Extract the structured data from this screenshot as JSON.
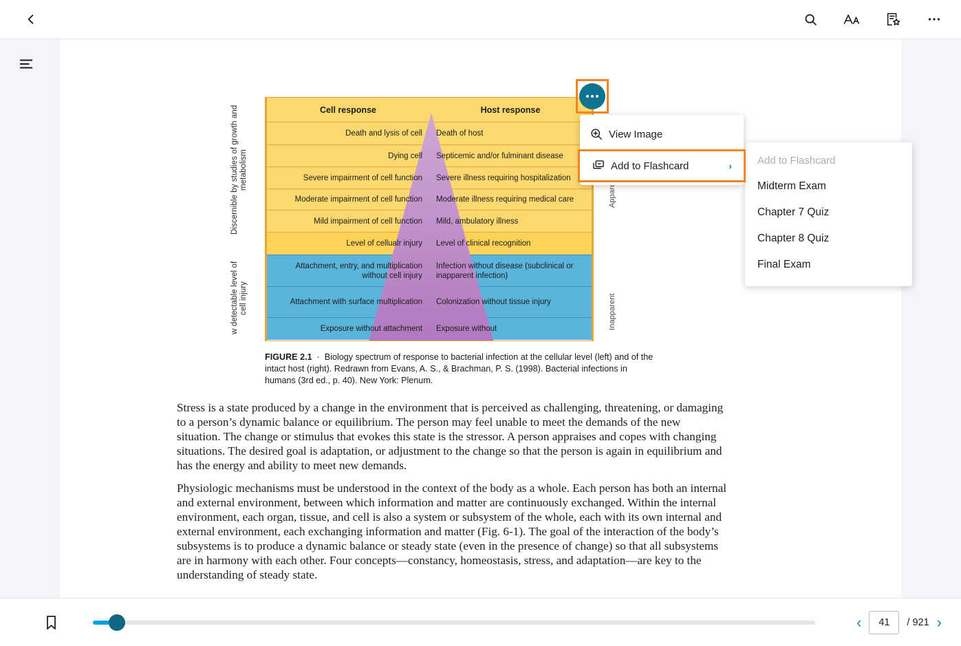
{
  "topbar": {
    "back_label": "Back",
    "icons": [
      {
        "name": "search-icon",
        "label": "Search"
      },
      {
        "name": "text-size-icon",
        "label": "Text Size"
      },
      {
        "name": "notes-star-icon",
        "label": "Notes and Highlights"
      },
      {
        "name": "more-options-icon",
        "label": "More"
      }
    ]
  },
  "rail": {
    "menu_label": "Contents"
  },
  "figure": {
    "left_axis_top": "Discernible by studies of growth and metabolism",
    "left_axis_bottom": "w detectable level of cell injury",
    "right_axis_top": "Appare",
    "right_axis_bottom": "Inapparent",
    "header": {
      "left": "Cell response",
      "right": "Host response"
    },
    "rows": [
      {
        "left": "Death and lysis of cell",
        "right": "Death of host",
        "band": "yellow"
      },
      {
        "left": "Dying cell",
        "right": "Septicemic and/or fulminant disease",
        "band": "yellow"
      },
      {
        "left": "Severe impairment of cell function",
        "right": "Severe illness requiring hospitalization",
        "band": "yellow"
      },
      {
        "left": "Moderate impairment of cell function",
        "right": "Moderate illness requiring medical care",
        "band": "yellow"
      },
      {
        "left": "Mild impairment of cell function",
        "right": "Mild, ambulatory illness",
        "band": "yellow"
      },
      {
        "left": "Level of cellualr injury",
        "right": "Level of clinical recognition",
        "band": "yellow2"
      },
      {
        "left": "Attachment, entry, and multiplication without cell injury",
        "right": "Infection without disease (subclinical or inapparent infection)",
        "band": "blue"
      },
      {
        "left": "Attachment with surface multiplication",
        "right": "Colonization without tissue injury",
        "band": "blue"
      },
      {
        "left": "Exposure without attachment",
        "right": "Exposure without",
        "band": "blue"
      }
    ],
    "caption_label": "FIGURE 2.1",
    "caption_sep": "·",
    "caption_text": "Biology spectrum of response to bacterial infection at the cellular level (left) and of the intact host (right). Redrawn from Evans, A. S., & Brachman, P. S. (1998). Bacterial infections in humans (3rd ed., p. 40). New York: Plenum."
  },
  "body": {
    "paragraph_1": "Stress is a state produced by a change in the environment that is perceived as challenging, threatening, or damaging to a person’s dynamic balance or equilibrium. The person may feel unable to meet the demands of the new situation. The change or stimulus that evokes this state is the stressor. A person appraises and copes with changing situations. The desired goal is adaptation, or adjustment to the change so that the person is again in equilibrium and has the energy and ability to meet new demands.",
    "paragraph_2": "Physiologic mechanisms must be understood in the context of the body as a whole. Each person has both an internal and external environment, between which information and matter are continuously exchanged. Within the internal environment, each organ, tissue, and cell is also a system or subsystem of the whole, each with its own internal and external environment, each exchanging information and matter (Fig. 6-1). The goal of the interaction of the body’s subsystems is to produce a dynamic balance or steady state (even in the presence of change) so that all subsystems are in harmony with each other. Four concepts—constancy, homeostasis, stress, and adaptation—are key to the understanding of steady state."
  },
  "context_menu": {
    "trigger_label": "More image options",
    "items": [
      {
        "label": "View Image",
        "icon": "zoom-in-icon",
        "has_arrow": false,
        "highlighted": false
      },
      {
        "label": "Add to Flashcard",
        "icon": "flashcard-icon",
        "has_arrow": true,
        "arrow": "›",
        "highlighted": true
      }
    ]
  },
  "submenu": {
    "heading": "Add to Flashcard",
    "items": [
      "Midterm Exam",
      "Chapter 7 Quiz",
      "Chapter 8 Quiz",
      "Final Exam"
    ]
  },
  "bottombar": {
    "bookmark_label": "Bookmark",
    "prev_label": "‹",
    "next_label": "›",
    "current_page": "41",
    "total_pages": "/ 921"
  },
  "colors": {
    "accent_teal": "#0e7490",
    "highlight_orange": "#f2851e",
    "link_blue": "#1787b8",
    "slider_blue": "#00a3e0",
    "band_yellow": "#fcd96e",
    "band_blue": "#5ab4dc",
    "triangle_purple": "#b07bbf"
  }
}
